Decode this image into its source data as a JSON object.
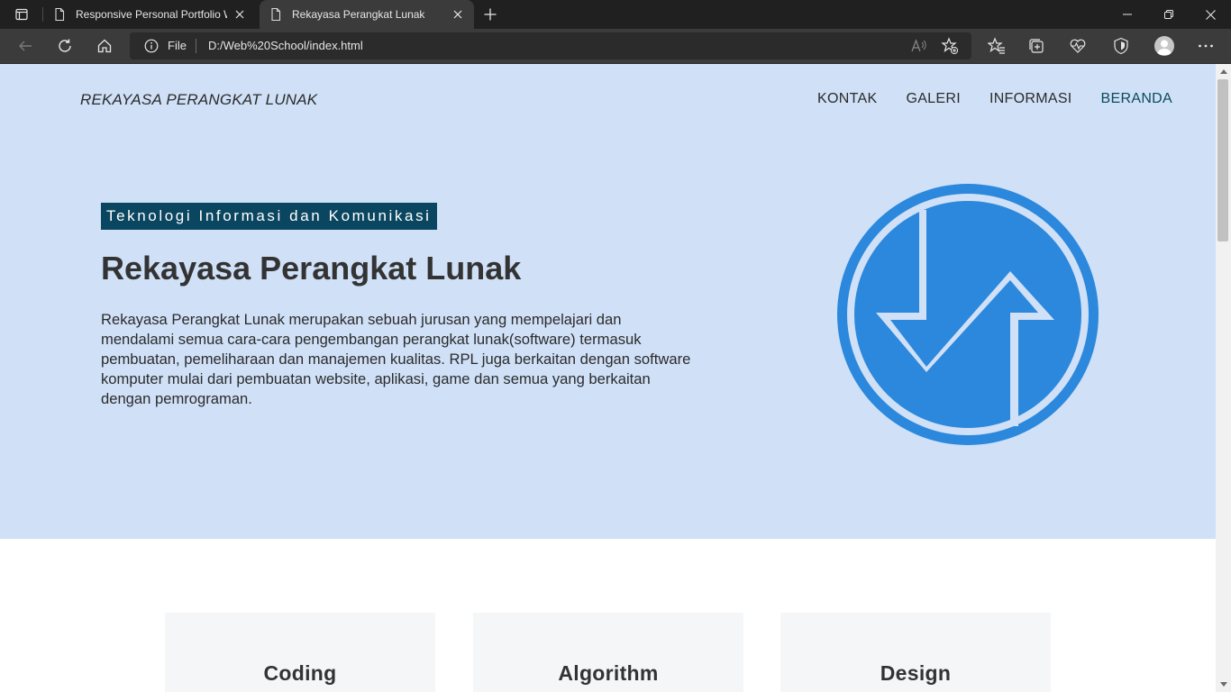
{
  "browser": {
    "tabs": [
      {
        "title": "Responsive Personal Portfolio We",
        "active": false
      },
      {
        "title": "Rekayasa Perangkat Lunak",
        "active": true
      }
    ],
    "address": {
      "scheme_label": "File",
      "url": "D:/Web%20School/index.html"
    }
  },
  "page": {
    "brand": "REKAYASA PERANGKAT LUNAK",
    "nav": [
      "KONTAK",
      "GALERI",
      "INFORMASI",
      "BERANDA"
    ],
    "nav_active": "BERANDA",
    "hero": {
      "badge": "Teknologi Informasi dan Komunikasi",
      "title": "Rekayasa Perangkat Lunak",
      "description": "Rekayasa Perangkat Lunak merupakan sebuah jurusan yang mempelajari dan mendalami semua cara-cara pengembangan perangkat lunak(software) termasuk pembuatan, pemeliharaan dan manajemen kualitas. RPL juga berkaitan dengan software komputer mulai dari pembuatan website, aplikasi, game dan semua yang berkaitan dengan pemrograman."
    },
    "cards": [
      "Coding",
      "Algorithm",
      "Design"
    ]
  },
  "colors": {
    "hero_bg": "#cfe0f7",
    "badge_bg": "#0b4660",
    "logo_blue": "#2b88dc",
    "nav_active": "#0b4a5e"
  }
}
